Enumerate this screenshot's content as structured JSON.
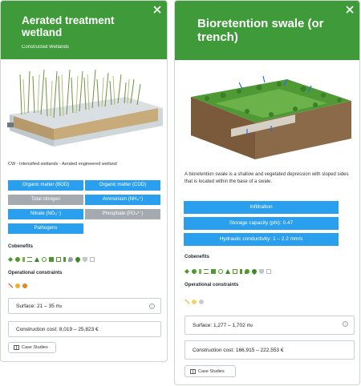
{
  "cards": [
    {
      "title": "Aerated treatment wetland",
      "subtitle": "Constructed Wetlands",
      "caption": "CW - Intensified wetlands - Aerated engineered wetland",
      "tags": [
        {
          "label": "Organic matter (BOD)",
          "color": "#2a9fed"
        },
        {
          "label": "Organic matter (COD)",
          "color": "#2a9fed"
        },
        {
          "label": "Total nitrogen",
          "color": "#a4aaaf"
        },
        {
          "label": "Ammonium (NH₄⁺)",
          "color": "#2a9fed"
        },
        {
          "label": "Nitrate (NO₃⁻)",
          "color": "#2a9fed"
        },
        {
          "label": "Phosphate (PO₄³⁻)",
          "color": "#a4aaaf"
        },
        {
          "label": "Pathogens",
          "color": "#2a9fed"
        }
      ],
      "cobenefits_label": "Cobenefits",
      "constraints_label": "Operational constraints",
      "surface_label": "Surface: 21 – 35 m",
      "surface_unit_exp": "2",
      "cost_label": "Construction cost: 8,019 – 25,823 €",
      "case_studies": "Case Studies"
    },
    {
      "title": "Bioretention swale (or trench)",
      "description": "A bioretention swale is a shallow and vegetated depression with sloped sides that is located within the base of a swale.",
      "tags": [
        {
          "label": "Infiltration"
        },
        {
          "label": "Storage capacity (phi): 0.47"
        },
        {
          "label": "Hydraulic conductivity: 1 – 2.2 mm/s"
        }
      ],
      "cobenefits_label": "Cobenefits",
      "constraints_label": "Operational constraints",
      "surface_label": "Surface: 1,277 – 1,702 m",
      "surface_unit_exp": "2",
      "cost_label": "Construction cost: 166,915 – 222,553 €",
      "case_studies": "Case Studies"
    }
  ],
  "colors": {
    "header_green": "#3f9b3a",
    "tag_blue": "#2a9fed",
    "tag_grey": "#a4aaaf"
  },
  "icons": {
    "card1_cobenefits": [
      "leaf-icon",
      "paw-icon",
      "thermometer-icon",
      "waves-icon",
      "tree-icon",
      "recycle-icon",
      "building-icon",
      "camera-icon",
      "walker-icon",
      "fire-icon",
      "drop-icon",
      "bowl-icon",
      "ticket-icon"
    ],
    "card1_constraints": [
      "tools-icon",
      "sun-icon",
      "gear-icon"
    ],
    "card2_cobenefits": [
      "leaf-icon",
      "paw-icon",
      "thermometer-icon",
      "waves-icon",
      "building-icon",
      "recycle-icon",
      "tree-icon",
      "camera-icon",
      "walker-icon",
      "fire-icon",
      "drop-icon",
      "bowl-icon",
      "ticket-icon"
    ],
    "card2_constraints": [
      "tools-icon",
      "sun-icon",
      "gear-icon"
    ]
  }
}
